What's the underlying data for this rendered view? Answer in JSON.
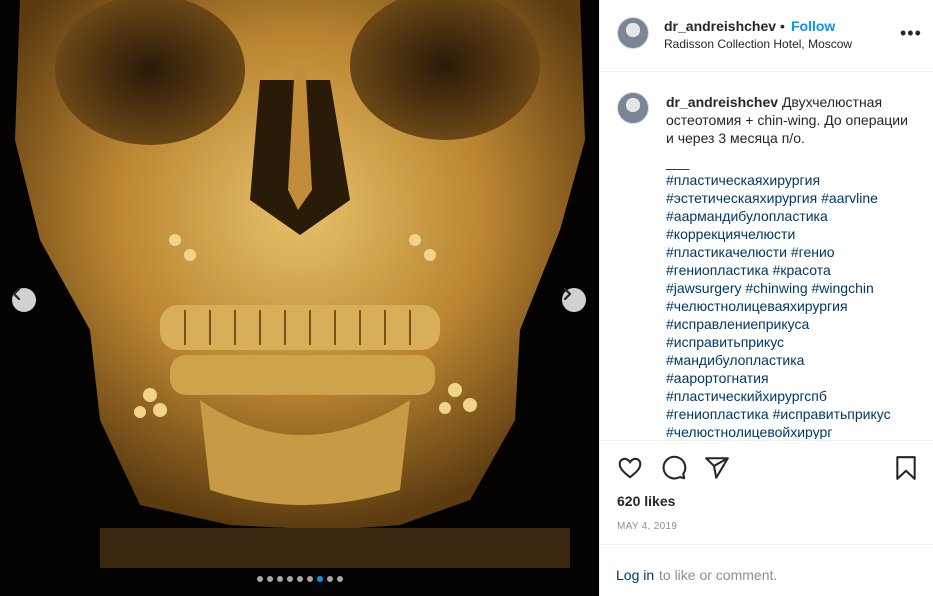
{
  "post": {
    "username": "dr_andreishchev",
    "bullet": "•",
    "follow_label": "Follow",
    "location": "Radisson Collection Hotel, Moscow",
    "more_label": "•••"
  },
  "caption": {
    "author": "dr_andreishchev",
    "text": "Двухчелюстная остеотомия + chin-wing. До операции и через 3 месяца п/о.",
    "separator": "___",
    "hashtag_lines": [
      "#пластическаяхирургия",
      "#эстетическаяхирургия #aarvline",
      "#аармандибулопластика",
      "#коррекциячелюсти",
      "#пластикачелюсти #генио",
      "#гениопластика #красота",
      "#jawsurgery #chinwing #wingchin",
      "#челюстнолицеваяхирургия",
      "#исправлениеприкуса",
      "#исправитьприкус",
      "#мандибулопластика",
      "#аарортогнатия",
      "#пластическийхирургспб",
      "#гениопластика #исправитьприкус",
      "#челюстнолицевойхирург"
    ]
  },
  "stats": {
    "likes": "620 likes",
    "date": "MAY 4, 2019"
  },
  "login": {
    "link": "Log in",
    "rest": "to like or comment."
  },
  "carousel": {
    "total": 9,
    "active_index": 6
  },
  "icons": {
    "prev": "chevron-left-icon",
    "next": "chevron-right-icon",
    "like": "heart-icon",
    "comment": "comment-icon",
    "share": "share-icon",
    "save": "bookmark-icon",
    "more": "more-icon"
  },
  "colors": {
    "accent": "#0095f6",
    "link": "#00376b",
    "muted": "#8e8e8e",
    "bone": "#c8993f"
  }
}
